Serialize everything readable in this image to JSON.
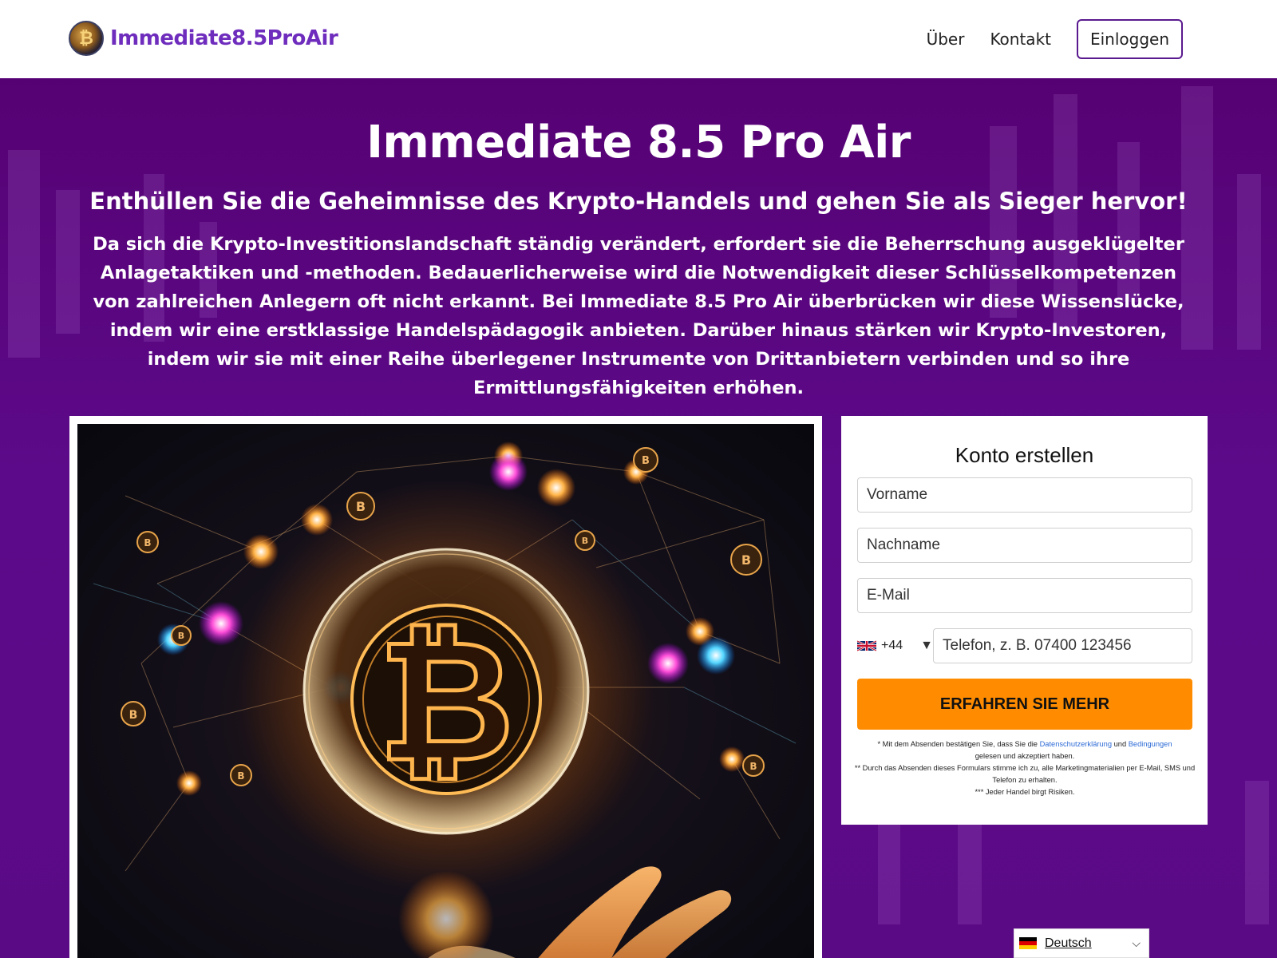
{
  "header": {
    "brand": "Immediate8.5ProAir",
    "logo_glyph": "₿",
    "nav": {
      "about": "Über",
      "contact": "Kontakt",
      "login": "Einloggen"
    }
  },
  "hero": {
    "title": "Immediate 8.5 Pro Air",
    "subtitle": "Enthüllen Sie die Geheimnisse des Krypto-Handels und gehen Sie als Sieger hervor!",
    "description": "Da sich die Krypto-Investitionslandschaft ständig verändert, erfordert sie die Beherrschung ausgeklügelter Anlagetaktiken und -methoden. Bedauerlicherweise wird die Notwendigkeit dieser Schlüsselkompetenzen von zahlreichen Anlegern oft nicht erkannt. Bei Immediate 8.5 Pro Air überbrücken wir diese Wissenslücke, indem wir eine erstklassige Handelspädagogik anbieten. Darüber hinaus stärken wir Krypto-Investoren, indem wir sie mit einer Reihe überlegener Instrumente von Drittanbietern verbinden und so ihre Ermittlungsfähigkeiten erhöhen."
  },
  "form": {
    "title": "Konto erstellen",
    "first_name_placeholder": "Vorname",
    "last_name_placeholder": "Nachname",
    "email_placeholder": "E-Mail",
    "phone_code": "+44",
    "phone_arrow": "▼",
    "phone_placeholder": "Telefon, z. B.  07400 123456",
    "submit": "ERFAHREN SIE MEHR",
    "disclaimer": {
      "line1_prefix": "* Mit dem Absenden bestätigen Sie, dass Sie die",
      "privacy_link": "Datenschutzerklärung",
      "and": "und",
      "terms_link": "Bedingungen",
      "line1_suffix": "gelesen und akzeptiert haben.",
      "line2": "** Durch das Absenden dieses Formulars stimme ich zu, alle Marketingmaterialien per E-Mail, SMS und Telefon zu erhalten.",
      "line3": "*** Jeder Handel birgt Risiken."
    }
  },
  "language": {
    "label": "Deutsch",
    "chevron": "⌵"
  },
  "image": {
    "coin_glyph": "₿",
    "small_coin_glyph": "B"
  },
  "colors": {
    "brand_purple": "#6f2dbd",
    "hero_bg": "#5b0a86",
    "cta_orange": "#ff8c00",
    "link_blue": "#2d6bd6"
  }
}
